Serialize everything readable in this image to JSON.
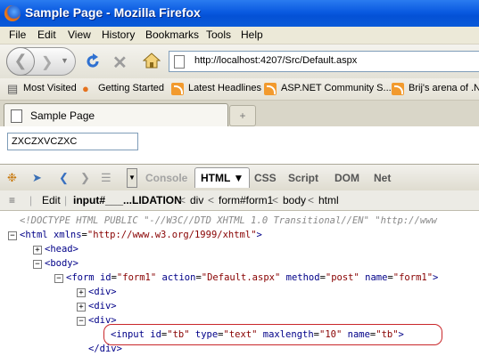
{
  "window": {
    "title": "Sample Page - Mozilla Firefox"
  },
  "menu": [
    "File",
    "Edit",
    "View",
    "History",
    "Bookmarks",
    "Tools",
    "Help"
  ],
  "nav": {
    "url": "http://localhost:4207/Src/Default.aspx"
  },
  "bookmarks": [
    "Most Visited",
    "Getting Started",
    "Latest Headlines",
    "ASP.NET Community S...",
    "Brij's arena of .N"
  ],
  "tabs": [
    {
      "title": "Sample Page"
    }
  ],
  "content": {
    "textbox_value": "ZXCZXVCZXC"
  },
  "firebug": {
    "panels": [
      "Console",
      "HTML",
      "CSS",
      "Script",
      "DOM",
      "Net"
    ],
    "active_panel": "HTML",
    "edit_label": "Edit",
    "breadcrumb": [
      "input#___...LIDATION",
      "div",
      "form#form1",
      "body",
      "html"
    ],
    "tree": {
      "doctype": "<!DOCTYPE HTML PUBLIC \"-//W3C//DTD XHTML 1.0 Transitional//EN\" \"http://www",
      "html_open": {
        "tag": "html",
        "attr": "xmlns",
        "value": "\"http://www.w3.org/1999/xhtml\""
      },
      "head": "<head>",
      "body": "<body>",
      "form": {
        "id": "\"form1\"",
        "action": "\"Default.aspx\"",
        "method": "\"post\"",
        "name": "\"form1\""
      },
      "div": "<div>",
      "div_close": "</div>",
      "input": {
        "id": "\"tb\"",
        "type": "\"text\"",
        "maxlength": "\"10\"",
        "name": "\"tb\""
      }
    }
  }
}
